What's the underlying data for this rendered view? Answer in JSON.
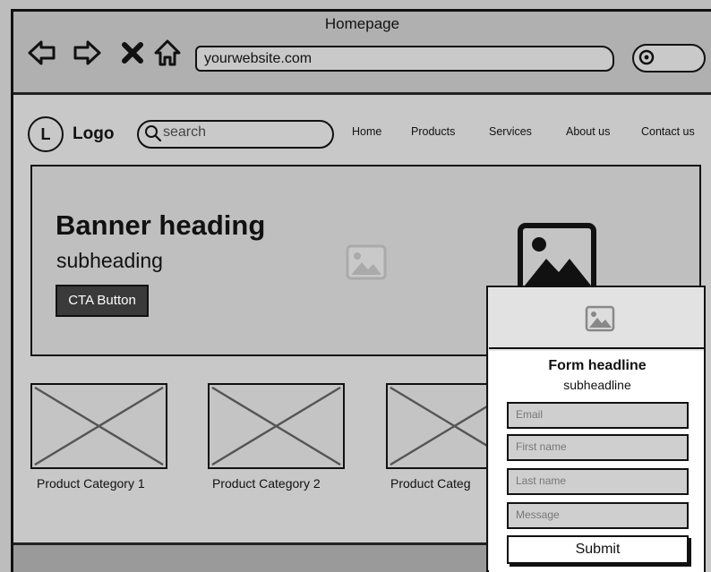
{
  "window": {
    "title": "Homepage"
  },
  "browser": {
    "url": "yourwebsite.com",
    "icons": [
      "back-arrow-icon",
      "forward-arrow-icon",
      "close-icon",
      "home-icon",
      "search-icon"
    ]
  },
  "site": {
    "logo_letter": "L",
    "logo_text": "Logo",
    "search_placeholder": "search",
    "nav": [
      "Home",
      "Products",
      "Services",
      "About us",
      "Contact us"
    ]
  },
  "banner": {
    "heading": "Banner heading",
    "subheading": "subheading",
    "cta": "CTA Button"
  },
  "products": [
    "Product Category 1",
    "Product Category 2",
    "Product Categ"
  ],
  "form": {
    "headline": "Form headline",
    "subheadline": "subheadline",
    "fields": [
      "Email",
      "First name",
      "Last name",
      "Message"
    ],
    "submit": "Submit"
  },
  "colors": {
    "frame": "#111111",
    "background": "#bdbdbd",
    "chrome": "#b0b0b0",
    "button_dark": "#3a3a3a"
  }
}
